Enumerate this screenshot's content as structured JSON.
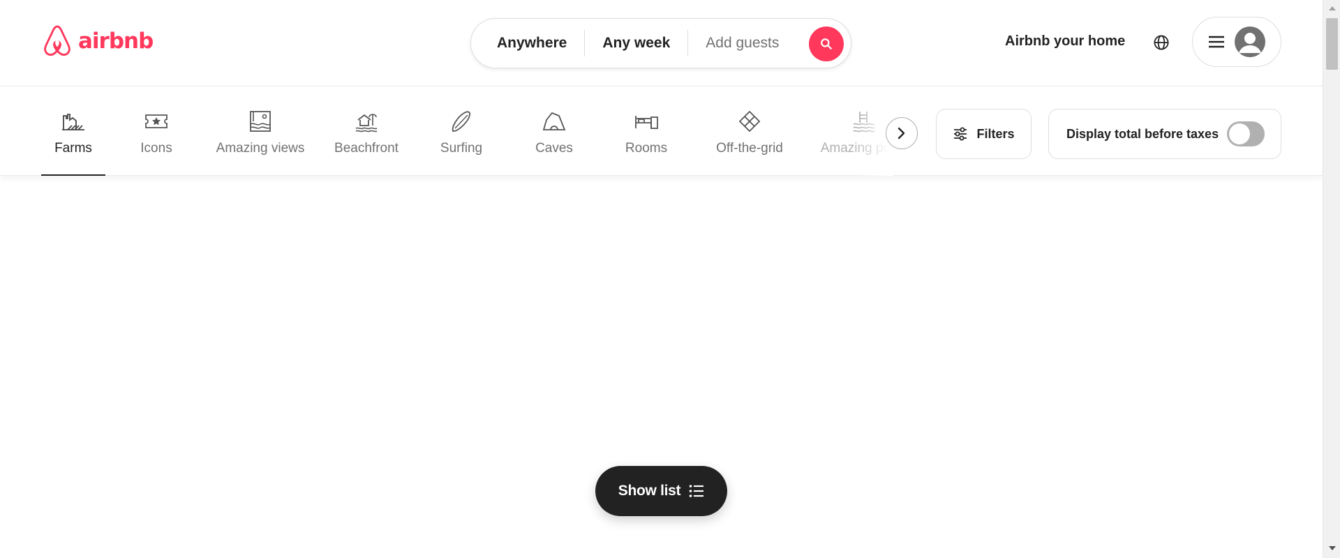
{
  "brand": {
    "name": "airbnb",
    "accent_color": "#ff385c"
  },
  "search": {
    "location": "Anywhere",
    "dates": "Any week",
    "guests_placeholder": "Add guests",
    "search_icon": "search-icon"
  },
  "header": {
    "host_link": "Airbnb your home",
    "globe_icon": "globe-icon",
    "menu_icon": "hamburger-menu-icon",
    "avatar_icon": "user-avatar-icon"
  },
  "categories": [
    {
      "label": "Farms",
      "icon": "farm-icon",
      "active": true
    },
    {
      "label": "Icons",
      "icon": "ticket-star-icon",
      "active": false
    },
    {
      "label": "Amazing views",
      "icon": "framed-view-icon",
      "active": false
    },
    {
      "label": "Beachfront",
      "icon": "beach-hut-icon",
      "active": false
    },
    {
      "label": "Surfing",
      "icon": "surfboard-icon",
      "active": false
    },
    {
      "label": "Caves",
      "icon": "cave-icon",
      "active": false
    },
    {
      "label": "Rooms",
      "icon": "bed-icon",
      "active": false
    },
    {
      "label": "Off-the-grid",
      "icon": "diamond-grid-icon",
      "active": false
    },
    {
      "label": "Amazing pools",
      "icon": "pool-icon",
      "active": false
    }
  ],
  "category_nav": {
    "next_icon": "chevron-right-icon"
  },
  "filters": {
    "label": "Filters",
    "icon": "sliders-icon"
  },
  "tax_toggle": {
    "label": "Display total before taxes",
    "enabled": false
  },
  "show_list": {
    "label": "Show list",
    "icon": "list-icon"
  }
}
